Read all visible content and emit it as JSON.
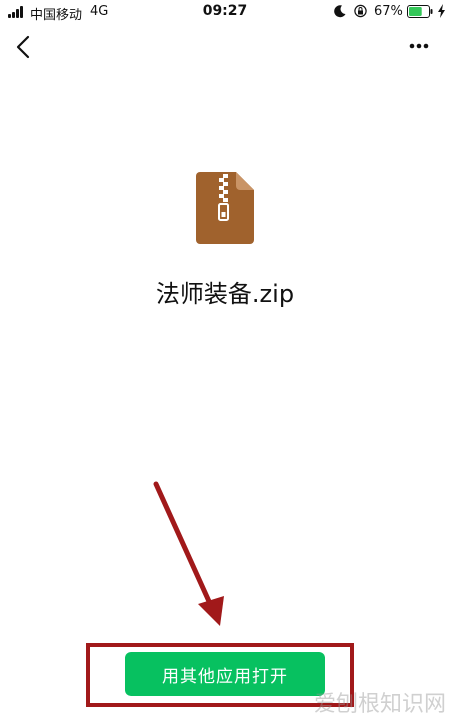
{
  "status_bar": {
    "carrier": "中国移动",
    "network": "4G",
    "time": "09:27",
    "battery_percent": "67%",
    "battery_level": 0.67,
    "icons": [
      "signal-icon",
      "moon-icon",
      "orientation-lock-icon",
      "battery-icon",
      "charging-icon"
    ]
  },
  "nav": {
    "back_icon": "chevron-left-icon",
    "more_icon": "more-dots-icon"
  },
  "file": {
    "icon": "zip-file-icon",
    "icon_color": "#a0622d",
    "name": "法师装备.zip"
  },
  "actions": {
    "open_with_other_app_label": "用其他应用打开",
    "button_color": "#07c160"
  },
  "annotation": {
    "color": "#a1191a"
  },
  "watermark": "爱刨根知识网"
}
